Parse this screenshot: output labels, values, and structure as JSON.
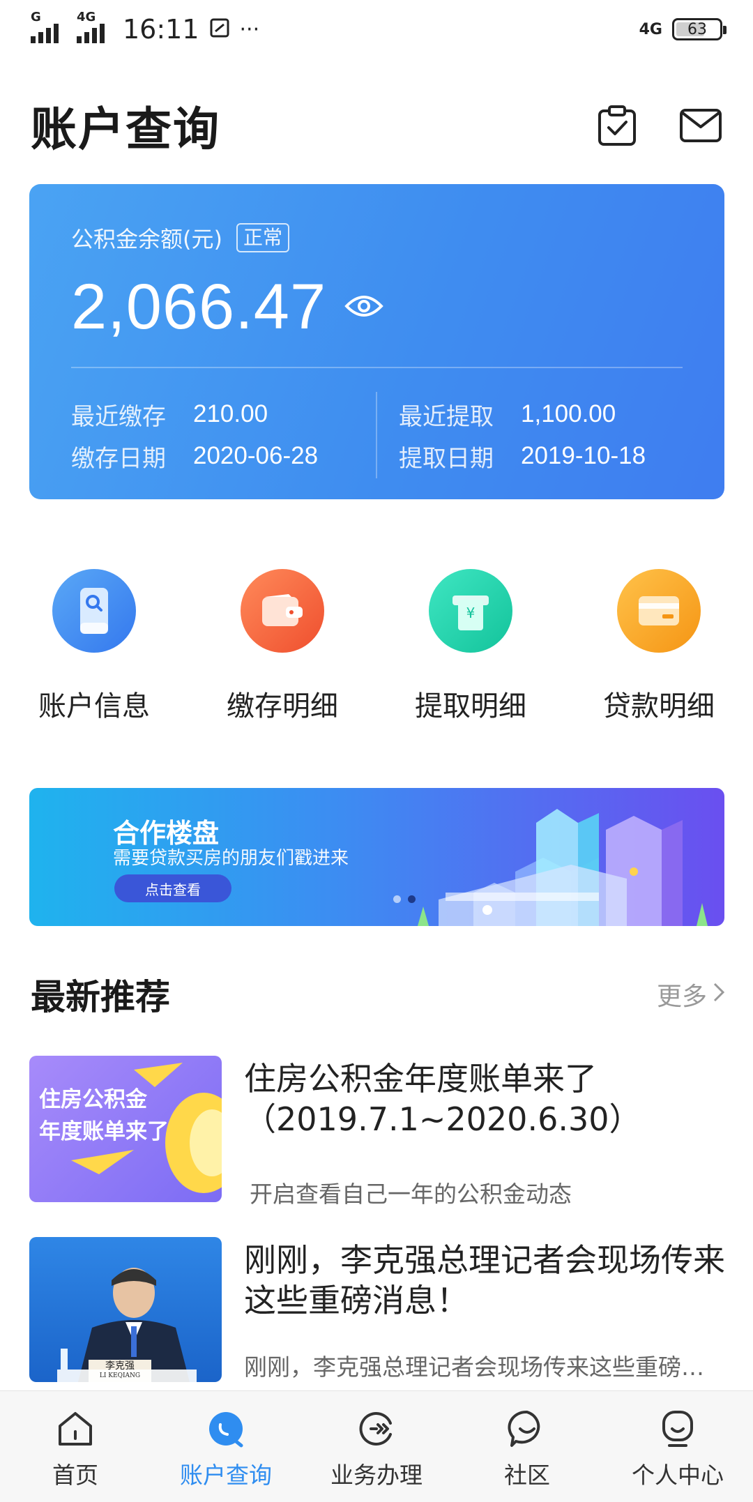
{
  "status_bar": {
    "sim1": "G",
    "sim2": "4G",
    "time": "16:11",
    "more": "···",
    "network": "4G",
    "battery": "63"
  },
  "header": {
    "title": "账户查询",
    "icons": [
      "clipboard-check-icon",
      "mail-icon"
    ]
  },
  "balance_card": {
    "label": "公积金余额(元)",
    "status": "正常",
    "amount": "2,066.47",
    "recent_deposit_label": "最近缴存",
    "recent_deposit_value": "210.00",
    "deposit_date_label": "缴存日期",
    "deposit_date_value": "2020-06-28",
    "recent_withdraw_label": "最近提取",
    "recent_withdraw_value": "1,100.00",
    "withdraw_date_label": "提取日期",
    "withdraw_date_value": "2019-10-18",
    "colors": {
      "from": "#4aa3f3",
      "to": "#3f7df0"
    }
  },
  "quick_actions": [
    {
      "label": "账户信息",
      "icon": "phone-search-icon",
      "color": "#3f8ff0"
    },
    {
      "label": "缴存明细",
      "icon": "wallet-icon",
      "color": "#f4623a"
    },
    {
      "label": "提取明细",
      "icon": "yuan-receipt-icon",
      "color": "#1fd0a8"
    },
    {
      "label": "贷款明细",
      "icon": "card-icon",
      "color": "#f7a21c"
    }
  ],
  "banner": {
    "title": "合作楼盘",
    "subtitle": "需要贷款买房的朋友们戳进来",
    "button": "点击查看"
  },
  "recommend": {
    "title": "最新推荐",
    "more": "更多"
  },
  "news": [
    {
      "thumb_text_line1": "住房公积金",
      "thumb_text_line2": "年度账单来了",
      "title": "住房公积金年度账单来了（2019.7.1~2020.6.30）",
      "desc": "开启查看自己一年的公积金动态"
    },
    {
      "thumb_nameplate": "李克强",
      "thumb_nameplate_en": "LI KEQIANG",
      "title": "刚刚，李克强总理记者会现场传来这些重磅消息！",
      "desc": "刚刚，李克强总理记者会现场传来这些重磅消息"
    }
  ],
  "tabs": [
    {
      "label": "首页",
      "icon": "home-icon"
    },
    {
      "label": "账户查询",
      "icon": "account-query-icon",
      "active": true
    },
    {
      "label": "业务办理",
      "icon": "business-icon"
    },
    {
      "label": "社区",
      "icon": "community-icon"
    },
    {
      "label": "个人中心",
      "icon": "profile-icon"
    }
  ]
}
